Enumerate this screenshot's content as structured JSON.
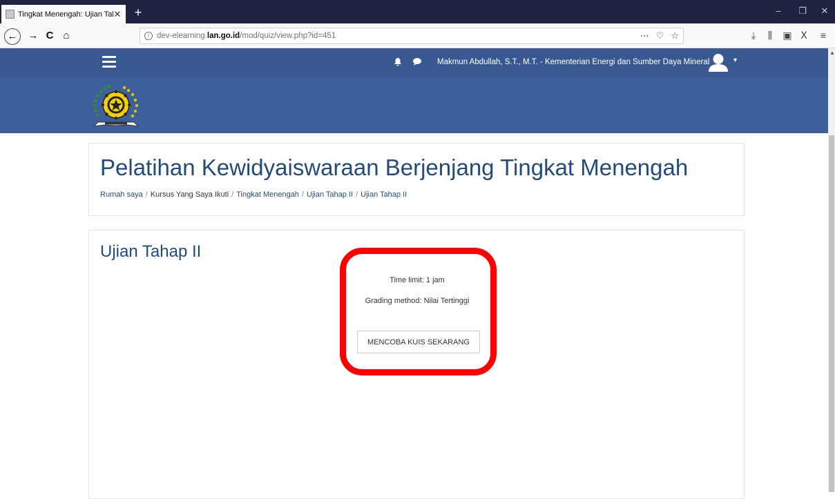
{
  "browser": {
    "tab_title": "Tingkat Menengah: Ujian Tahap",
    "url_prefix": "dev-elearning.",
    "url_domain": "lan.go.id",
    "url_path": "/mod/quiz/view.php?id=451"
  },
  "header": {
    "username": "Makmun Abdullah, S.T., M.T. - Kementerian Energi dan Sumber Daya Mineral"
  },
  "course": {
    "title": "Pelatihan Kewidyaiswaraan Berjenjang Tingkat Menengah",
    "breadcrumb": [
      "Rumah saya",
      "Kursus Yang Saya Ikuti",
      "Tingkat Menengah",
      "Ujian Tahap II",
      "Ujian Tahap II"
    ],
    "breadcrumb_sep": "/"
  },
  "quiz": {
    "title": "Ujian Tahap II",
    "time_limit": "Time limit: 1 jam",
    "grading_method": "Grading method: Nilai Tertinggi",
    "attempt_button": "MENCOBA KUIS SEKARANG"
  },
  "colors": {
    "header_bg": "#38598f",
    "banner_bg": "#3d609c",
    "link": "#234b7a",
    "highlight": "#ff0000"
  }
}
